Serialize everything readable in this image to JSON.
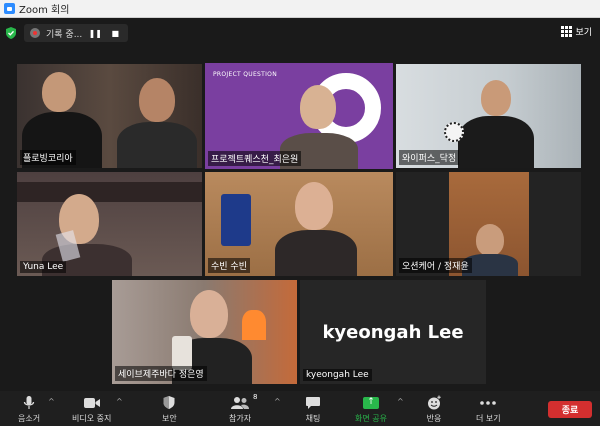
{
  "window": {
    "title": "Zoom 회의"
  },
  "recording": {
    "label": "기록 중...",
    "pause": "❚❚",
    "stop": "■"
  },
  "view": {
    "label": "보기"
  },
  "tiles": [
    {
      "name": "플로빙코리아"
    },
    {
      "name": "프로젝트퀘스천_최은원",
      "overlay": "PROJECT QUESTION"
    },
    {
      "name": "와이퍼스_닥정"
    },
    {
      "name": "Yuna Lee"
    },
    {
      "name": "수빈 수빈"
    },
    {
      "name": "오션케어 / 정재윤"
    },
    {
      "name": "세이브제주바다 정은영"
    },
    {
      "name": "kyeongah Lee",
      "display": "kyeongah Lee"
    }
  ],
  "toolbar": {
    "mic": "음소거",
    "video": "비디오 중지",
    "security": "보안",
    "participants": "참가자",
    "participants_count": "8",
    "chat": "채팅",
    "share": "화면 공유",
    "reactions": "반응",
    "more": "더 보기",
    "end": "종료"
  },
  "colors": {
    "accent": "#c7e24b",
    "share": "#29b74b",
    "end": "#d32f2f",
    "purple": "#7a3fa0"
  }
}
